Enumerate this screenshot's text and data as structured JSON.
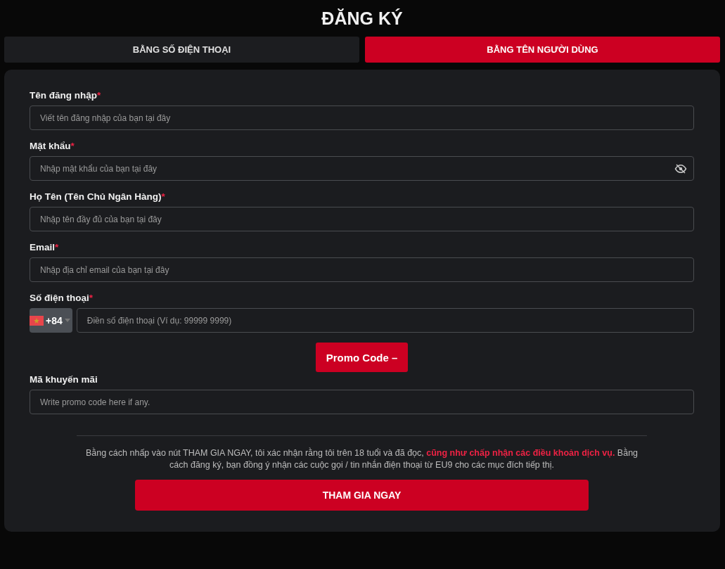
{
  "title": "ĐĂNG KÝ",
  "tabs": [
    {
      "label": "BẰNG SỐ ĐIỆN THOẠI",
      "selected": false
    },
    {
      "label": "BẰNG TÊN NGƯỜI DÙNG",
      "selected": true
    }
  ],
  "fields": [
    {
      "kind": "text",
      "label": "Tên đăng nhập",
      "mark": "*",
      "placeholder": "Viết tên đăng nhập của bạn tại đây"
    },
    {
      "kind": "password",
      "label": "Mật khẩu",
      "mark": "*",
      "placeholder": "Nhập mật khẩu của bạn tại đây"
    },
    {
      "kind": "text",
      "label": "Họ Tên (Tên Chủ Ngân Hàng)",
      "mark": "*",
      "placeholder": "Nhập tên đầy đủ của bạn tại đây"
    },
    {
      "kind": "text",
      "label": "Email",
      "mark": "*",
      "placeholder": "Nhập địa chỉ email của bạn tại đây"
    },
    {
      "kind": "phone",
      "label": "Số điện thoại",
      "mark": "*",
      "code": "+84",
      "placeholder": "Điền số điện thoại (Ví dụ: 99999 9999)"
    }
  ],
  "promo_toggle": "Promo Code –",
  "promo_field": {
    "label": "Mã khuyến mãi",
    "placeholder": "Write promo code here if any."
  },
  "terms": {
    "before": "Bằng cách nhấp vào nút THAM GIA NGAY, tôi xác nhận rằng tôi trên 18 tuổi và đã đọc,",
    "link": "cũng như chấp nhận các điều khoản dịch vụ.",
    "after": "Bằng cách đăng ký, bạn đồng ý nhận các cuộc gọi / tin nhắn điện thoại từ EU9 cho các mục đích tiếp thị."
  },
  "submit": "THAM GIA NGAY"
}
